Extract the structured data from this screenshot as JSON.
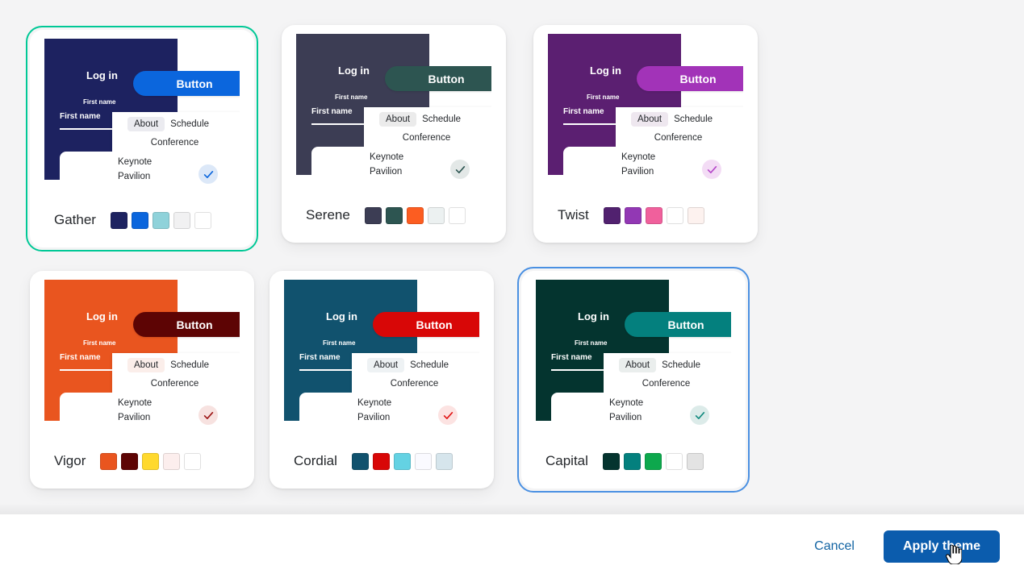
{
  "footer": {
    "cancel_label": "Cancel",
    "apply_label": "Apply theme",
    "cancel_color": "#1264a3",
    "apply_bg": "#0b5cad"
  },
  "preview_labels": {
    "login": "Log in",
    "sublabel": "First name",
    "field_label": "First name",
    "button": "Button",
    "tab_about": "About",
    "tab_schedule": "Schedule",
    "tab_conference": "Conference",
    "panel_line1": "Keynote",
    "panel_line2": "Pavilion"
  },
  "themes": [
    {
      "name": "Gather",
      "selected": true,
      "ring_color": "#00c896",
      "hero_bg": "#1d2260",
      "button_bg": "#0b66dd",
      "tab_active_bg": "#ebebf0",
      "check_bg": "#dce8f8",
      "check_color": "#0b66dd",
      "swatches": [
        "#1d2260",
        "#0b66dd",
        "#8fd2da",
        "#f1f1f2",
        "#ffffff"
      ]
    },
    {
      "name": "Serene",
      "selected": false,
      "ring_color": "transparent",
      "hero_bg": "#3c3d54",
      "button_bg": "#2d5551",
      "tab_active_bg": "#ebebeb",
      "check_bg": "#e3e8e7",
      "check_color": "#2d5551",
      "swatches": [
        "#3c3d54",
        "#2d5551",
        "#fc5d21",
        "#ecf1f1",
        "#ffffff"
      ]
    },
    {
      "name": "Twist",
      "selected": false,
      "ring_color": "transparent",
      "hero_bg": "#5b1f71",
      "button_bg": "#a233b8",
      "tab_active_bg": "#eee7ef",
      "check_bg": "#f3dcf5",
      "check_color": "#b548c9",
      "swatches": [
        "#51216f",
        "#9238b4",
        "#f0609c",
        "#ffffff",
        "#fdf2ef"
      ]
    },
    {
      "name": "Vigor",
      "selected": false,
      "ring_color": "transparent",
      "hero_bg": "#e9551f",
      "button_bg": "#5d0404",
      "tab_active_bg": "#fbeeea",
      "check_bg": "#f7e2e0",
      "check_color": "#9c1414",
      "swatches": [
        "#e9551f",
        "#5d0404",
        "#ffd92e",
        "#fceeed",
        "#ffffff"
      ]
    },
    {
      "name": "Cordial",
      "selected": false,
      "ring_color": "transparent",
      "hero_bg": "#11526e",
      "button_bg": "#d80707",
      "tab_active_bg": "#eef2f4",
      "check_bg": "#fce3e2",
      "check_color": "#e11515",
      "swatches": [
        "#11526e",
        "#d80707",
        "#64d2e3",
        "#fafaff",
        "#d6e5ec"
      ]
    },
    {
      "name": "Capital",
      "selected": true,
      "ring_color": "#4a90e2",
      "hero_bg": "#04342f",
      "button_bg": "#04807e",
      "tab_active_bg": "#eaeeed",
      "check_bg": "#dcebe9",
      "check_color": "#118a7e",
      "swatches": [
        "#04342f",
        "#04807e",
        "#0da84d",
        "#ffffff",
        "#e3e3e3"
      ]
    }
  ],
  "cursor": {
    "icon": "pointer-hand-cursor"
  }
}
